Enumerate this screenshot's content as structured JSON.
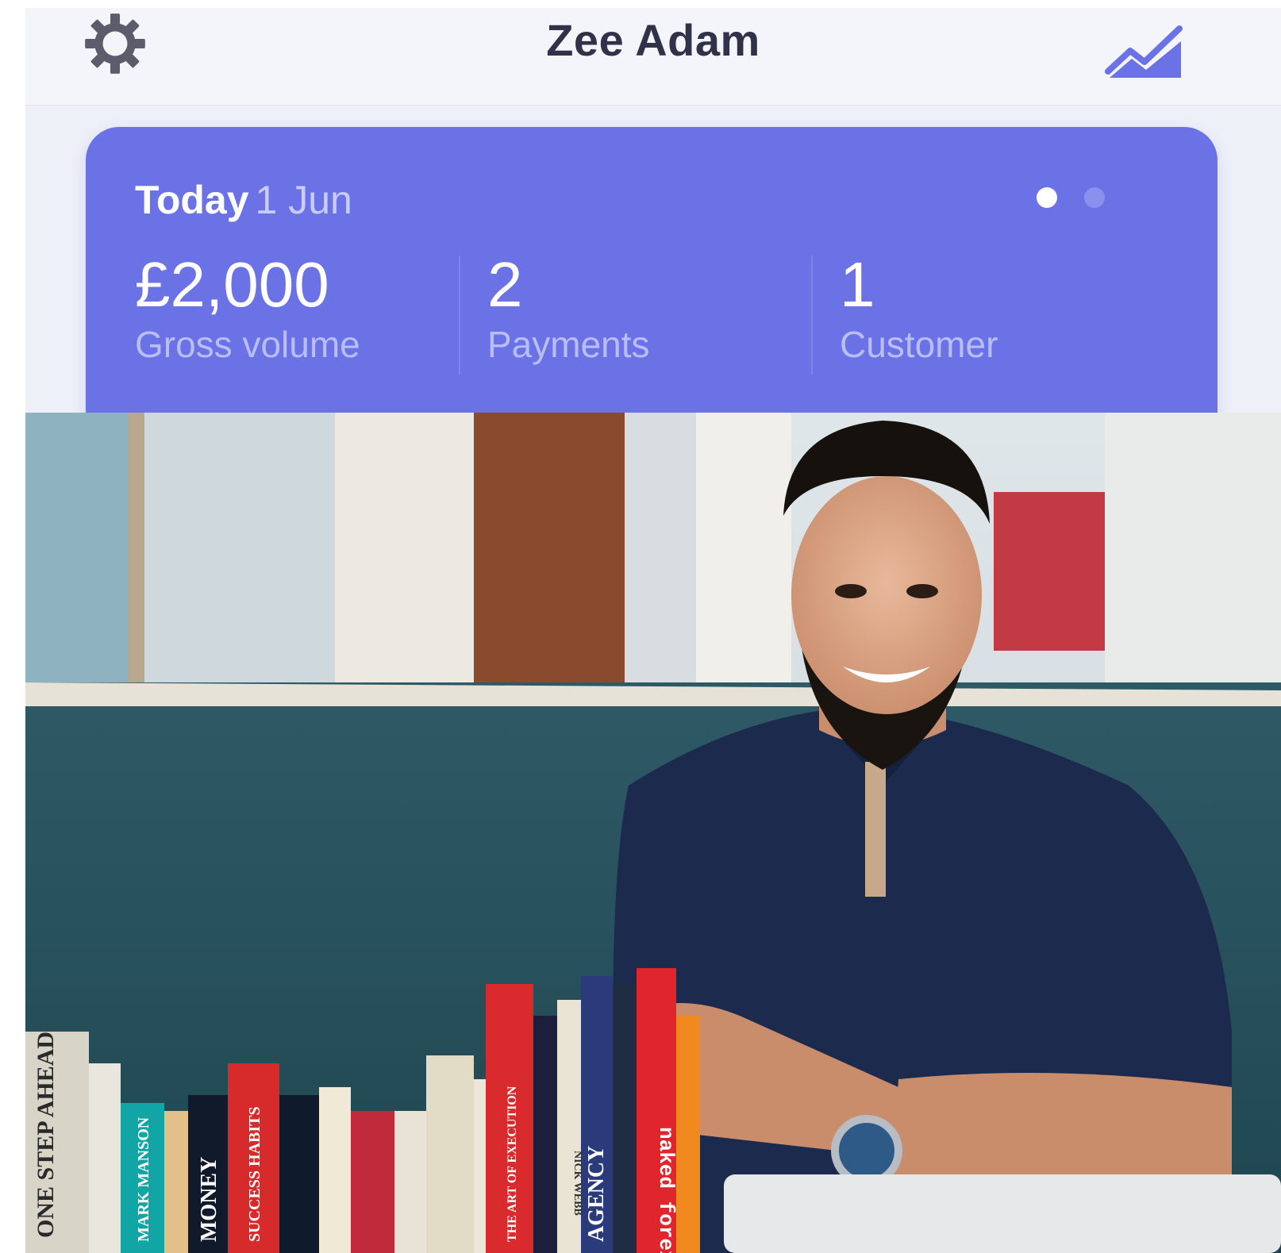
{
  "header": {
    "title": "Zee Adam",
    "settings_icon": "gear-icon",
    "chart_icon": "trend-chart-icon"
  },
  "summary": {
    "period_label": "Today",
    "date": "1 Jun",
    "page_dots": {
      "count": 2,
      "active_index": 0
    },
    "stats": [
      {
        "value": "£2,000",
        "label": "Gross volume"
      },
      {
        "value": "2",
        "label": "Payments"
      },
      {
        "value": "1",
        "label": "Customer"
      }
    ]
  },
  "photo": {
    "book_spines": [
      "ONE STEP AHEAD",
      "MARK MANSON",
      "MONEY",
      "SUCCESS HABITS",
      "THE ART OF EXECUTION",
      "NICK WEBB",
      "AGENCY",
      "naked forex"
    ]
  },
  "colors": {
    "accent": "#6a72e6",
    "header_bg": "#f4f5fa",
    "title_text": "#30324a",
    "icon_gray": "#5c5c6c",
    "chart_icon": "#6a72e6"
  }
}
